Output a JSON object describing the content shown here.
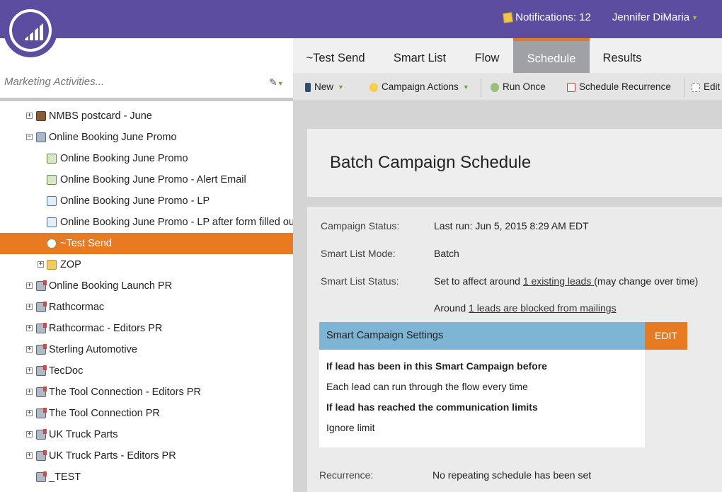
{
  "header": {
    "notifications_label": "Notifications: 12",
    "user_name": "Jennifer DiMaria"
  },
  "left_pane": {
    "search_placeholder": "Marketing Activities...",
    "tree": [
      {
        "label": "NMBS postcard - June",
        "icon": "book-icon",
        "expander": "+"
      },
      {
        "label": "Online Booking June Promo",
        "icon": "program-icon",
        "expander": "−"
      },
      {
        "label": "Online Booking June Promo",
        "icon": "email-icon",
        "expander": ""
      },
      {
        "label": "Online Booking June Promo - Alert Email",
        "icon": "email-icon",
        "expander": ""
      },
      {
        "label": "Online Booking June Promo - LP",
        "icon": "landing-page-icon",
        "expander": ""
      },
      {
        "label": "Online Booking June Promo - LP after form filled out",
        "icon": "landing-page-icon",
        "expander": ""
      },
      {
        "label": "~Test Send",
        "icon": "smart-campaign-icon",
        "expander": "",
        "selected": true
      },
      {
        "label": "ZOP",
        "icon": "folder-icon",
        "expander": "+"
      },
      {
        "label": "Online Booking Launch PR",
        "icon": "mailbox-icon",
        "expander": "+"
      },
      {
        "label": "Rathcormac",
        "icon": "mailbox-icon",
        "expander": "+"
      },
      {
        "label": "Rathcormac - Editors PR",
        "icon": "mailbox-icon",
        "expander": "+"
      },
      {
        "label": "Sterling Automotive",
        "icon": "mailbox-icon",
        "expander": "+"
      },
      {
        "label": "TecDoc",
        "icon": "mailbox-icon",
        "expander": "+"
      },
      {
        "label": "The Tool Connection - Editors PR",
        "icon": "mailbox-icon",
        "expander": "+"
      },
      {
        "label": "The Tool Connection PR",
        "icon": "mailbox-icon",
        "expander": "+"
      },
      {
        "label": "UK Truck Parts",
        "icon": "mailbox-icon",
        "expander": "+"
      },
      {
        "label": "UK Truck Parts - Editors PR",
        "icon": "mailbox-icon",
        "expander": "+"
      },
      {
        "label": "_TEST",
        "icon": "mailbox-icon",
        "expander": ""
      }
    ]
  },
  "tabs": [
    "~Test Send",
    "Smart List",
    "Flow",
    "Schedule",
    "Results"
  ],
  "active_tab": "Schedule",
  "toolbar": {
    "new_label": "New",
    "campaign_actions_label": "Campaign Actions",
    "run_once_label": "Run Once",
    "schedule_recurrence_label": "Schedule Recurrence",
    "edit_label": "Edit"
  },
  "schedule": {
    "title": "Batch Campaign Schedule",
    "campaign_status_label": "Campaign Status:",
    "campaign_status_value": "Last run: Jun 5, 2015 8:29 AM EDT",
    "smart_list_mode_label": "Smart List Mode:",
    "smart_list_mode_value": "Batch",
    "smart_list_status_label": "Smart List Status:",
    "status_prefix": "Set to affect around ",
    "status_link": "1 existing leads ",
    "status_suffix": "(may change over time)",
    "around_prefix": "Around ",
    "around_link": "1 leads are blocked from mailings",
    "settings_title": "Smart Campaign Settings",
    "edit_button": "EDIT",
    "setting_1_heading": "If lead has been in this Smart Campaign before",
    "setting_1_value": "Each lead can run through the flow every time",
    "setting_2_heading": "If lead has reached the communication limits",
    "setting_2_value": "Ignore limit",
    "recurrence_label": "Recurrence:",
    "recurrence_value": "No repeating schedule has been set"
  },
  "colors": {
    "topbar": "#5c4da0",
    "accent_orange": "#e87b22",
    "settings_header": "#7eb4d4"
  }
}
